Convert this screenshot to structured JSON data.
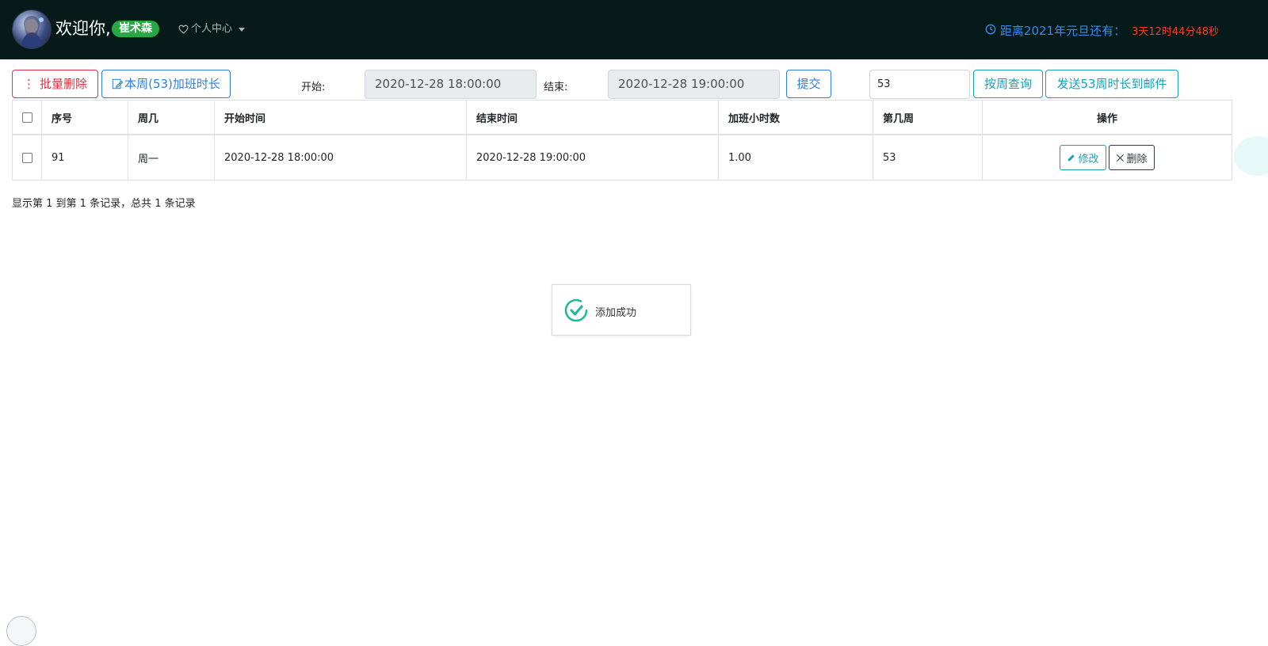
{
  "header": {
    "welcome": "欢迎你,",
    "username": "崔术森",
    "profile_menu": "个人中心",
    "countdown_label": "距离2021年元旦还有：",
    "countdown_time": "3天12时44分48秒",
    "icons": {
      "profile": "heart-icon",
      "countdown": "clock-icon",
      "avatar": "avatar-image"
    }
  },
  "toolbar": {
    "batch_delete": "批量删除",
    "week_hours": "本周(53)加班时长",
    "start_label": "开始:",
    "start_value": "2020-12-28 18:00:00",
    "end_label": "结束:",
    "end_value": "2020-12-28 19:00:00",
    "submit": "提交",
    "week_value": "53",
    "query_by_week": "按周查询",
    "send_email": "发送53周时长到邮件"
  },
  "table": {
    "headers": [
      "序号",
      "周几",
      "开始时间",
      "结束时间",
      "加班小时数",
      "第几周",
      "操作"
    ],
    "rows": [
      {
        "id": "91",
        "weekday": "周一",
        "start": "2020-12-28 18:00:00",
        "end": "2020-12-28 19:00:00",
        "hours": "1.00",
        "week": "53",
        "edit": "修改",
        "delete": "删除"
      }
    ]
  },
  "pagination": {
    "info": "显示第 1 到第 1 条记录，总共 1 条记录"
  },
  "toast": {
    "message": "添加成功"
  },
  "colors": {
    "header_bg": "#061b19",
    "badge": "#28a745",
    "danger": "#dc3545",
    "primary": "#2f7fe0",
    "info": "#17a2b8",
    "countdown_label": "#2f8cf4",
    "countdown_time": "#ff3b1f",
    "success_check": "#1fb89a"
  }
}
